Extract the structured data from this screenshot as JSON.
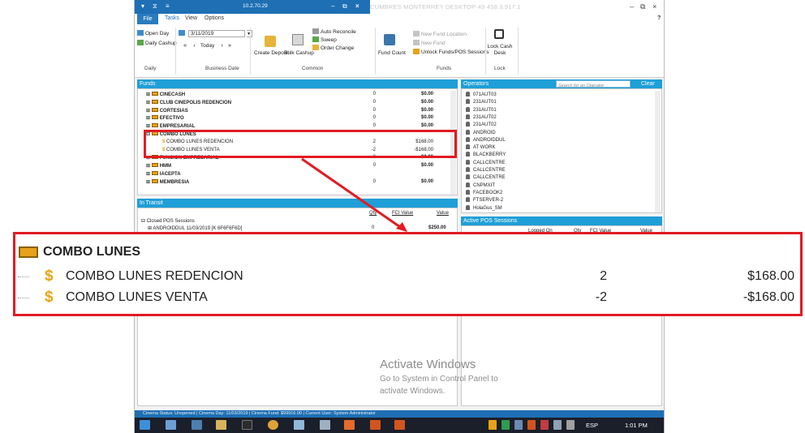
{
  "titlebar": {
    "ip": "10.2.70.29",
    "title": "CUMBRES MONTERREY   DESKTOP-49   458.3.917.1",
    "help": "?"
  },
  "tabs": [
    "File",
    "Tasks",
    "View",
    "Options"
  ],
  "ribbon": {
    "open_day": "Open Day",
    "daily_cashup": "Daily Cashup",
    "date_value": "3/11/2019",
    "today": "Today",
    "create_deposit": "Create Deposit",
    "bulk_cashup": "Bulk Cashup",
    "auto_reconcile": "Auto Reconcile",
    "sweep": "Sweep",
    "order_change": "Order Change",
    "fund_count": "Fund Count",
    "new_fund_location": "New Fund Location",
    "new_fund": "New Fund",
    "unlock_funds": "Unlock Funds/POS Sessions",
    "lock_cash_desk": "Lock Cash Desk",
    "groups": {
      "daily": "Daily",
      "business_date": "Business Date",
      "common": "Common",
      "funds": "Funds",
      "lock": "Lock"
    }
  },
  "funds": {
    "title": "Funds",
    "rows": [
      {
        "name": "CINECASH",
        "qty": "0",
        "amount": "$0.00"
      },
      {
        "name": "CLUB CINEPOLIS REDENCION",
        "qty": "0",
        "amount": "$0.00"
      },
      {
        "name": "CORTESIAS",
        "qty": "0",
        "amount": "$0.00"
      },
      {
        "name": "EFECTIVO",
        "qty": "0",
        "amount": "$0.00"
      },
      {
        "name": "EMPRESARIAL",
        "qty": "0",
        "amount": "$0.00"
      },
      {
        "name": "COMBO LUNES",
        "qty": "",
        "amount": ""
      },
      {
        "name": "COMBO LUNES REDENCION",
        "qty": "2",
        "amount": "$168.00"
      },
      {
        "name": "COMBO LUNES VENTA",
        "qty": "-2",
        "amount": "-$168.00"
      },
      {
        "name": "FUNCION EMPRESARIAL",
        "qty": "0",
        "amount": "$0.00"
      },
      {
        "name": "HMM",
        "qty": "0",
        "amount": "$0.00"
      },
      {
        "name": "IACEPTA",
        "qty": "",
        "amount": ""
      },
      {
        "name": "MEMBRESIA",
        "qty": "0",
        "amount": "$0.00"
      }
    ]
  },
  "operators": {
    "title": "Operators",
    "search_placeholder": "Search for an Operator",
    "clear": "Clear",
    "items": [
      "071AUT03",
      "231AUT01",
      "231AUT01",
      "231AUT02",
      "231AUT02",
      "ANDROID",
      "ANDROIDDUL",
      "AT WORK",
      "BLACKBERRY",
      "CALLCENTRE",
      "CALLCENTRE",
      "CALLCENTRE",
      "CNPMXIT",
      "FACEBOOK2",
      "FTSERVER-2",
      "HolaGus_SM"
    ]
  },
  "in_transit": {
    "title": "In Transit",
    "col_qty": "Qty",
    "col_fci": "FCI Value",
    "col_value": "Value",
    "group": "Closed POS Sessions",
    "session": "ANDROIDDUL 11/03/2019 [K 6F6F6F6D]",
    "session_qty": "0",
    "session_value": "$250.00"
  },
  "active_pos": {
    "title": "Active POS Sessions",
    "col_logged": "Logged On",
    "col_qty": "Qty",
    "col_fci": "FCI Value",
    "col_value": "Value"
  },
  "zoom": {
    "group_name": "COMBO LUNES",
    "rows": [
      {
        "label": "COMBO LUNES REDENCION",
        "qty": "2",
        "amount": "$168.00"
      },
      {
        "label": "COMBO LUNES VENTA",
        "qty": "-2",
        "amount": "-$168.00"
      }
    ]
  },
  "watermark": {
    "title": "Activate Windows",
    "subtitle": "Go to System in Control Panel to activate Windows."
  },
  "status_bar": "Cinema Status: Unopened   |   Cinema Day: 11/03/2019   |   Cinema Fund: $99916.00   |   Current User: System Administrator",
  "taskbar": {
    "language": "ESP",
    "time": "1:01 PM"
  },
  "colors": {
    "accent": "#1f9fd7",
    "highlight_red": "#e11b22",
    "fund_gold": "#e8a317"
  }
}
